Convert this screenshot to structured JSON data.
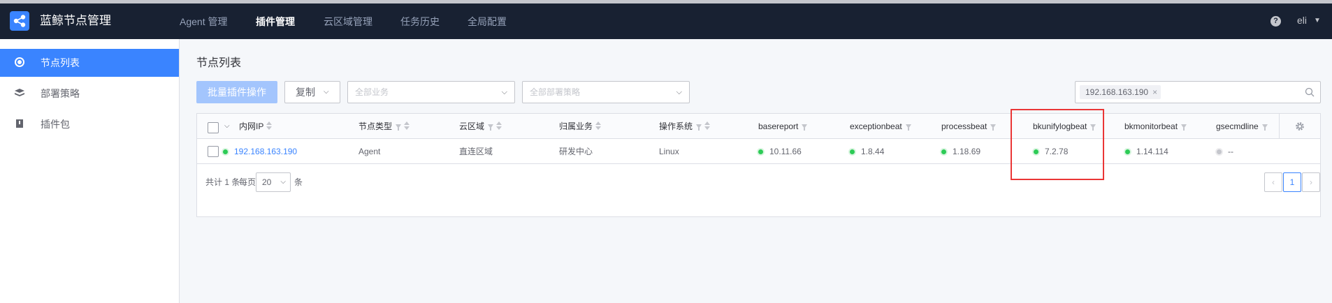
{
  "app": {
    "title": "蓝鲸节点管理"
  },
  "nav": [
    {
      "label": "Agent 管理",
      "active": false
    },
    {
      "label": "插件管理",
      "active": true
    },
    {
      "label": "云区域管理",
      "active": false
    },
    {
      "label": "任务历史",
      "active": false
    },
    {
      "label": "全局配置",
      "active": false
    }
  ],
  "user": {
    "help": "?",
    "name": "eli"
  },
  "sidebar": {
    "items": [
      {
        "label": "节点列表",
        "icon": "node-list-icon",
        "active": true
      },
      {
        "label": "部署策略",
        "icon": "deploy-policy-icon",
        "active": false
      },
      {
        "label": "插件包",
        "icon": "plugin-package-icon",
        "active": false
      }
    ]
  },
  "page": {
    "title": "节点列表"
  },
  "toolbar": {
    "batch_label": "批量插件操作",
    "copy_label": "复制",
    "business_placeholder": "全部业务",
    "policy_placeholder": "全部部署策略",
    "search_tag": "192.168.163.190"
  },
  "table": {
    "headers": {
      "ip": "内网IP",
      "node_type": "节点类型",
      "cloud": "云区域",
      "business": "归属业务",
      "os": "操作系统",
      "basereport": "basereport",
      "exceptionbeat": "exceptionbeat",
      "processbeat": "processbeat",
      "bkunifylogbeat": "bkunifylogbeat",
      "bkmonitorbeat": "bkmonitorbeat",
      "gsecmdline": "gsecmdline"
    },
    "rows": [
      {
        "ip": "192.168.163.190",
        "node_type": "Agent",
        "cloud": "直连区域",
        "business": "研发中心",
        "os": "Linux",
        "basereport": "10.11.66",
        "exceptionbeat": "1.8.44",
        "processbeat": "1.18.69",
        "bkunifylogbeat": "7.2.78",
        "bkmonitorbeat": "1.14.114",
        "gsecmdline": "--"
      }
    ]
  },
  "pagination": {
    "total_text": "共计 1 条",
    "per_page_label": "每页",
    "page_size": "20",
    "unit": "条",
    "prev": "‹",
    "current": "1",
    "next": "›"
  },
  "colors": {
    "primary": "#3a84ff",
    "topbar": "#182132",
    "success": "#2dcb56",
    "highlight": "#ea3636"
  }
}
